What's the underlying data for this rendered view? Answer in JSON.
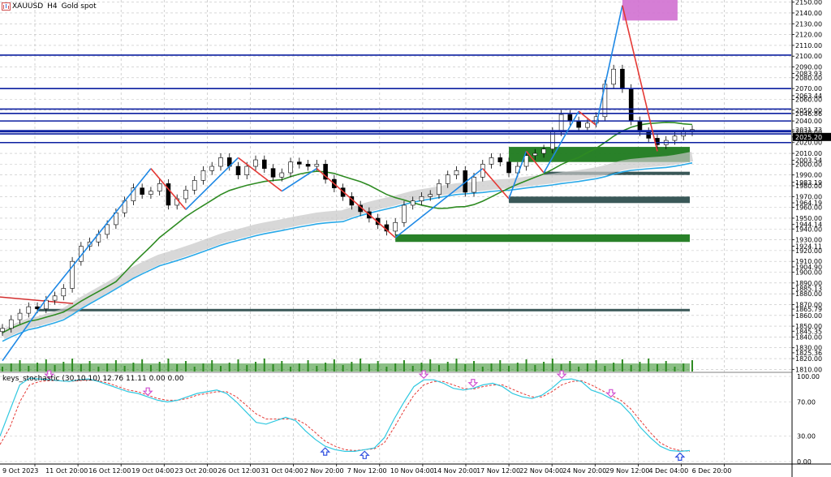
{
  "window": {
    "symbol": "XAUUSD",
    "timeframe": "H4",
    "description": "Gold spot",
    "icon": "chart-window-icon"
  },
  "indicator": {
    "label": "keys_stochastic (30,10,10) 12.76 11.11 0.00 0.00",
    "levels": [
      "100.00",
      "70.00",
      "30.00",
      "0.00"
    ]
  },
  "price_axis": {
    "labels": [
      "2150.00",
      "2140.00",
      "2130.00",
      "2120.00",
      "2110.00",
      "2100.00",
      "2090.00",
      "2083.93",
      "2080.00",
      "2070.00",
      "2063.44",
      "2060.00",
      "2050.00",
      "2046.86",
      "2040.00",
      "2031.73",
      "2030.00",
      "2025.20",
      "2020.00",
      "2010.00",
      "2003.54",
      "2000.00",
      "1990.00",
      "1983.19",
      "1980.00",
      "1970.00",
      "1964.19",
      "1960.00",
      "1950.00",
      "1944.14",
      "1940.00",
      "1930.00",
      "1924.11",
      "1920.00",
      "1910.00",
      "1904.90",
      "1900.00",
      "1890.00",
      "1885.13",
      "1880.00",
      "1870.00",
      "1865.79",
      "1860.00",
      "1850.00",
      "1845.35",
      "1840.00",
      "1830.00",
      "1825.36",
      "1820.00",
      "1810.00"
    ],
    "current_price": "2025.20"
  },
  "time_axis": {
    "labels": [
      "9 Oct 2023",
      "11 Oct 20:00",
      "16 Oct 12:00",
      "19 Oct 04:00",
      "23 Oct 20:00",
      "26 Oct 12:00",
      "31 Oct 04:00",
      "2 Nov 20:00",
      "7 Nov 12:00",
      "10 Nov 04:00",
      "14 Nov 20:00",
      "17 Nov 12:00",
      "22 Nov 04:00",
      "24 Nov 20:00",
      "29 Nov 12:00",
      "4 Dec 04:00",
      "6 Dec 20:00"
    ]
  },
  "colors": {
    "background": "#ffffff",
    "grid": "#c0c0c0",
    "bull_candle": "#000000",
    "bear_candle": "#000000",
    "horizontal_level": "#0b1fa0",
    "zigzag_up": "#1e88e5",
    "zigzag_down": "#e53935",
    "ma_green": "#2e8b22",
    "ma_blue": "#29a9e8",
    "ma_red": "#d32f2f",
    "ma_band": "#c8c8c8",
    "zone_green": "#1e7a1e",
    "zone_dark": "#2f4f4f",
    "zone_magenta": "#d070d0",
    "volume": "#2e8b22",
    "stoch_main": "#30c8e0",
    "stoch_signal": "#e53935",
    "arrow_up": "#3050e0",
    "arrow_down": "#d050d0"
  },
  "chart_data": {
    "type": "candlestick",
    "title": "XAUUSD, H4:  Gold spot",
    "x": [
      "9 Oct 2023",
      "11 Oct 20:00",
      "16 Oct 12:00",
      "19 Oct 04:00",
      "23 Oct 20:00",
      "26 Oct 12:00",
      "31 Oct 04:00",
      "2 Nov 20:00",
      "7 Nov 12:00",
      "10 Nov 04:00",
      "14 Nov 20:00",
      "17 Nov 12:00",
      "22 Nov 04:00",
      "24 Nov 20:00",
      "29 Nov 12:00",
      "4 Dec 04:00",
      "6 Dec 20:00"
    ],
    "ylim": [
      1808,
      2152
    ],
    "close_series": [
      1848,
      1856,
      1862,
      1868,
      1866,
      1874,
      1878,
      1885,
      1910,
      1924,
      1928,
      1935,
      1944,
      1955,
      1966,
      1978,
      1972,
      1975,
      1982,
      1962,
      1968,
      1976,
      1985,
      1994,
      1998,
      2006,
      1998,
      1990,
      1998,
      2004,
      1996,
      1988,
      1992,
      2002,
      2000,
      1998,
      2000,
      1986,
      1978,
      1970,
      1962,
      1956,
      1950,
      1944,
      1938,
      1946,
      1962,
      1966,
      1970,
      1972,
      1982,
      1990,
      1994,
      1974,
      1988,
      2000,
      2006,
      2002,
      1992,
      1998,
      2008,
      2010,
      2014,
      2030,
      2046,
      2040,
      2034,
      2038,
      2044,
      2074,
      2088,
      2070,
      2040,
      2030,
      2024,
      2018,
      2022,
      2026,
      2030,
      2032
    ],
    "levels": [
      2101,
      2070,
      2051,
      2047,
      2040,
      2031,
      2030,
      2028,
      2020
    ],
    "zigzag": [
      {
        "x_index": 0,
        "price": 1818
      },
      {
        "x_index": 5,
        "price": 1875
      },
      {
        "x_index": 17,
        "price": 1996
      },
      {
        "x_index": 21,
        "price": 1958
      },
      {
        "x_index": 27,
        "price": 2006
      },
      {
        "x_index": 32,
        "price": 1975
      },
      {
        "x_index": 36,
        "price": 1996
      },
      {
        "x_index": 45,
        "price": 1932
      },
      {
        "x_index": 55,
        "price": 1996
      },
      {
        "x_index": 58,
        "price": 1968
      },
      {
        "x_index": 60,
        "price": 2012
      },
      {
        "x_index": 62,
        "price": 1992
      },
      {
        "x_index": 66,
        "price": 2049
      },
      {
        "x_index": 68,
        "price": 2036
      },
      {
        "x_index": 71,
        "price": 2147
      },
      {
        "x_index": 75,
        "price": 2012
      }
    ],
    "zones": [
      {
        "from_index": 58,
        "price_top": 2016,
        "price_bottom": 2002,
        "kind": "green"
      },
      {
        "from_index": 62,
        "price_top": 1993,
        "price_bottom": 1990,
        "kind": "dark"
      },
      {
        "from_index": 58,
        "price_top": 1970,
        "price_bottom": 1964,
        "kind": "dark"
      },
      {
        "from_index": 45,
        "price_top": 1935,
        "price_bottom": 1928,
        "kind": "green"
      },
      {
        "from_index": 4,
        "price_top": 1866,
        "price_bottom": 1864,
        "kind": "dark"
      },
      {
        "from_index": 71,
        "price_top": 2152,
        "price_bottom": 2133,
        "kind": "magenta"
      }
    ],
    "stochastic": {
      "main": [
        30,
        60,
        90,
        98,
        97,
        96,
        95,
        94,
        96,
        97,
        94,
        90,
        86,
        82,
        80,
        76,
        72,
        70,
        72,
        76,
        80,
        82,
        84,
        80,
        70,
        58,
        46,
        44,
        48,
        52,
        48,
        36,
        26,
        18,
        14,
        12,
        12,
        14,
        16,
        28,
        50,
        70,
        88,
        96,
        96,
        92,
        86,
        84,
        86,
        90,
        92,
        88,
        80,
        76,
        74,
        78,
        86,
        96,
        97,
        94,
        84,
        80,
        74,
        68,
        56,
        40,
        28,
        18,
        13,
        12,
        13
      ],
      "signal": [
        20,
        40,
        70,
        90,
        94,
        95,
        95,
        94,
        95,
        96,
        95,
        92,
        88,
        84,
        82,
        78,
        74,
        72,
        72,
        74,
        78,
        80,
        82,
        82,
        76,
        66,
        56,
        50,
        50,
        50,
        50,
        44,
        34,
        24,
        18,
        14,
        13,
        14,
        15,
        22,
        40,
        60,
        78,
        90,
        94,
        94,
        90,
        86,
        85,
        88,
        90,
        90,
        85,
        80,
        76,
        76,
        82,
        90,
        94,
        95,
        90,
        84,
        78,
        72,
        62,
        48,
        34,
        22,
        16,
        13,
        12
      ],
      "up_arrows": [
        33,
        37,
        69
      ],
      "down_arrows": [
        5,
        15,
        43,
        48,
        57,
        62
      ]
    }
  }
}
